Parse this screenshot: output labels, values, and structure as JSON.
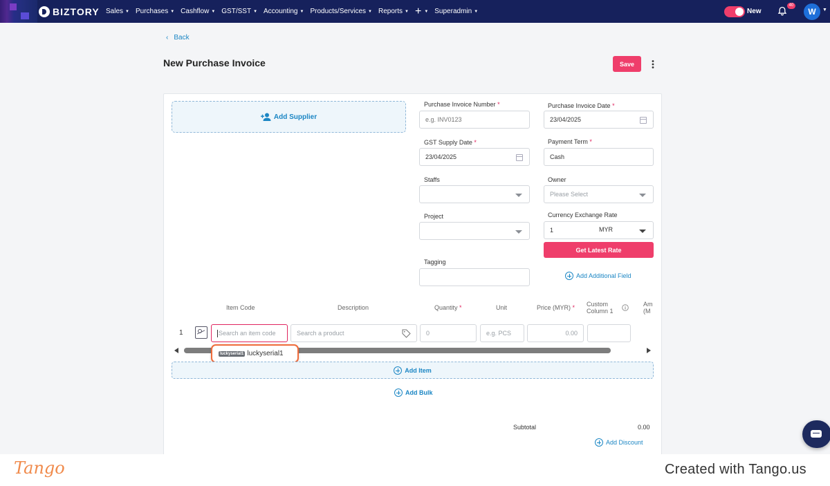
{
  "app": {
    "brand": "BIZTORY"
  },
  "nav": {
    "items": [
      "Sales",
      "Purchases",
      "Cashflow",
      "GST/SST",
      "Accounting",
      "Products/Services",
      "Reports"
    ],
    "plus": "+",
    "admin": "Superadmin",
    "toggle_label": "New",
    "notif_count": "40",
    "avatar": "W"
  },
  "page": {
    "back": "Back",
    "title": "New Purchase Invoice",
    "save": "Save"
  },
  "form": {
    "add_supplier": "Add Supplier",
    "invoice_number": {
      "label": "Purchase Invoice Number",
      "placeholder": "e.g. INV0123"
    },
    "invoice_date": {
      "label": "Purchase Invoice Date",
      "value": "23/04/2025"
    },
    "supply_date": {
      "label": "GST Supply Date",
      "value": "23/04/2025"
    },
    "payment_term": {
      "label": "Payment Term",
      "value": "Cash"
    },
    "staffs": {
      "label": "Staffs"
    },
    "owner": {
      "label": "Owner",
      "placeholder": "Please Select"
    },
    "project": {
      "label": "Project"
    },
    "exchange": {
      "label": "Currency Exchange Rate",
      "value": "1",
      "currency": "MYR"
    },
    "get_rate": "Get Latest Rate",
    "tagging": {
      "label": "Tagging"
    },
    "add_field": "Add Additional Field"
  },
  "table": {
    "headers": {
      "item_code": "Item Code",
      "description": "Description",
      "quantity": "Quantity",
      "unit": "Unit",
      "price": "Price (MYR)",
      "custom1_a": "Custom",
      "custom1_b": "Column 1",
      "amount_a": "Am",
      "amount_b": "(M"
    },
    "row": {
      "num": "1",
      "item_code_placeholder": "Search an item code",
      "desc_placeholder": "Search a product",
      "qty_placeholder": "0",
      "unit_placeholder": "e.g. PCS",
      "price_placeholder": "0.00"
    },
    "suggestion": {
      "tag": "luckyserial1",
      "text": "luckyserial1"
    },
    "add_item": "Add Item",
    "add_bulk": "Add Bulk"
  },
  "totals": {
    "subtotal_label": "Subtotal",
    "subtotal_value": "0.00",
    "add_discount": "Add Discount"
  },
  "footer": {
    "logo": "Tango",
    "credit": "Created with Tango.us"
  },
  "colors": {
    "nav_bg": "#16215c",
    "accent": "#ef3e6b",
    "link": "#1b86c4",
    "highlight": "#f06b3a"
  }
}
